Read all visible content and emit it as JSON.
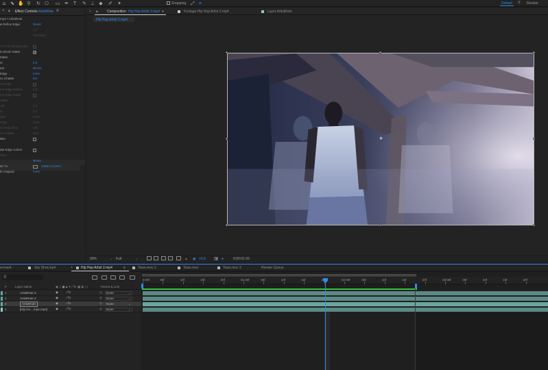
{
  "toolbar": {
    "snapping_label": "Snapping",
    "workspace_default": "Default",
    "workspace_menu": "≡",
    "workspace_review": "Review"
  },
  "effect_controls": {
    "tab_close": "×",
    "tab_title": "Effect Controls",
    "tab_layer": "ArtistRote",
    "tab_menu": "≡",
    "rows": [
      {
        "label": "mp4 • ArtistRote",
        "value": "",
        "type": "text",
        "dim": false
      },
      {
        "label": "& Refine Edge",
        "value": "Reset",
        "type": "value",
        "dim": false
      },
      {
        "label": "",
        "value": "1.0",
        "type": "value",
        "dim": true
      },
      {
        "label": "",
        "value": "Standard",
        "type": "value",
        "dim": true
      },
      {
        "label": "",
        "value": "",
        "type": "blank",
        "dim": true
      },
      {
        "label": "Around Background",
        "value": "",
        "type": "check",
        "checked": false,
        "dim": true
      },
      {
        "label": "to Brush Matte",
        "value": "",
        "type": "check",
        "checked": true,
        "dim": false
      },
      {
        "label": "Matte",
        "value": "",
        "type": "text",
        "dim": false
      },
      {
        "label": "er",
        "value": "5.0",
        "type": "value",
        "dim": false
      },
      {
        "label": "ast",
        "value": "80.0%",
        "type": "value",
        "dim": false
      },
      {
        "label": "Edge",
        "value": "0.0%",
        "type": "value",
        "dim": false
      },
      {
        "label": "ce Chatter",
        "value": "0%",
        "type": "value",
        "dim": false
      },
      {
        "label": "ne Edge",
        "value": "",
        "type": "check",
        "checked": false,
        "dim": true
      },
      {
        "label": "ine Edge Radius",
        "value": "3.0",
        "type": "value",
        "dim": true
      },
      {
        "label": "ine Edge Matte",
        "value": "",
        "type": "check",
        "checked": false,
        "dim": true
      },
      {
        "label": "Matte",
        "value": "",
        "type": "text",
        "dim": true
      },
      {
        "label": "oth",
        "value": "0.0",
        "type": "value",
        "dim": true
      },
      {
        "label": "er",
        "value": "0.0",
        "type": "value",
        "dim": true
      },
      {
        "label": "rast",
        "value": "0.0%",
        "type": "value",
        "dim": true
      },
      {
        "label": "Edge",
        "value": "0.0%",
        "type": "value",
        "dim": true
      },
      {
        "label": "ce Reduction",
        "value": "Off",
        "type": "value",
        "dim": true
      },
      {
        "label": "ce Chatter",
        "value": "50%",
        "type": "value",
        "dim": true
      },
      {
        "label": "Blur",
        "value": "",
        "type": "check",
        "checked": false,
        "dim": false
      },
      {
        "label": "",
        "value": "",
        "type": "blank",
        "dim": true
      },
      {
        "label": "ate Edge Colors",
        "value": "",
        "type": "check",
        "checked": false,
        "dim": false
      },
      {
        "label": "ation",
        "value": "",
        "type": "text",
        "dim": true
      },
      {
        "label": "",
        "value": "Reset",
        "type": "value",
        "dim": false
      },
      {
        "label": "ter To",
        "value": "1469.0,1419.0",
        "type": "point",
        "dim": false
      },
      {
        "label": "th Original",
        "value": "0.0%",
        "type": "value",
        "dim": false
      }
    ]
  },
  "composition": {
    "tabs": [
      {
        "label": "Composition",
        "layer": "Hip Hop Artist 2.mp4",
        "menu": "≡",
        "active": true
      },
      {
        "label": "Footage  Hip Hop Artist 2.mp4",
        "active": false
      },
      {
        "label": "Layer  ArtistRote",
        "active": false
      }
    ],
    "subtab": "Hip Hop Artist 2.mp4",
    "footer": {
      "zoom": "50%",
      "resolution": "Full",
      "exposure": "+0.0",
      "timecode": "0:00:01:20"
    }
  },
  "timeline": {
    "tabs": [
      {
        "label": "ercmp4",
        "active": false
      },
      {
        "label": "Sky Shot.mp4",
        "active": false
      },
      {
        "label": "Hip Hop Artist 2.mp4",
        "active": true
      },
      {
        "label": "Town.mov 2",
        "active": false
      },
      {
        "label": "Town.mov",
        "active": false
      },
      {
        "label": "Town.mov 3",
        "active": false
      },
      {
        "label": "Render Queue",
        "active": false
      }
    ],
    "header": {
      "hash": "#",
      "layer_name": "Layer Name",
      "parent_link": "Parent & Link"
    },
    "layers": [
      {
        "num": "1",
        "name": "ArtistRote 3",
        "parent": "None",
        "color": "#5fa8a0",
        "selected": false
      },
      {
        "num": "2",
        "name": "ArtistRote 2",
        "parent": "None",
        "color": "#5fa8a0",
        "selected": false
      },
      {
        "num": "3",
        "name": "ArtistRote",
        "parent": "None",
        "color": "#5fa8a0",
        "selected": true
      },
      {
        "num": "4",
        "name": "[Hip Ho....mp4.mp4]",
        "parent": "None",
        "color": "#8ad0c8",
        "selected": false
      }
    ],
    "ruler": [
      "0:00f",
      "05f",
      "10f",
      "15f",
      "20f",
      "01:00f",
      "05f",
      "10f",
      "15f",
      "20f",
      "02:00f",
      "05f",
      "10f",
      "15f",
      "20f",
      "03:00f",
      "05f",
      "10f",
      "15f",
      "20f"
    ],
    "playhead_time": "0:00:01:20"
  },
  "colors": {
    "accent": "#2d8ceb",
    "panel": "#232323",
    "green": "#3ec13e"
  }
}
